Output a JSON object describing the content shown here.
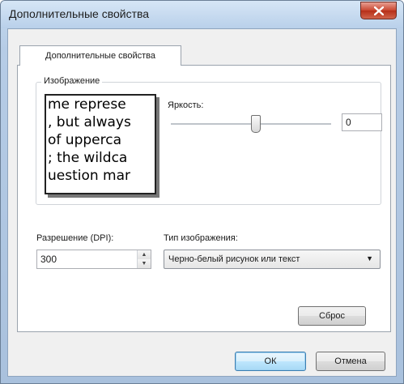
{
  "window": {
    "title": "Дополнительные свойства",
    "close_glyph": "✕"
  },
  "tabs": [
    {
      "label": "Дополнительные свойства",
      "selected": true
    }
  ],
  "image_group": {
    "legend": "Изображение",
    "preview_lines": [
      "me represe",
      ", but always",
      " of upperca",
      "; the wildca",
      "uestion mar"
    ]
  },
  "brightness": {
    "label": "Яркость:",
    "value": "0",
    "slider_level": 0.5
  },
  "resolution": {
    "label": "Разрешение (DPI):",
    "value": "300",
    "up_glyph": "▲",
    "down_glyph": "▼"
  },
  "image_type": {
    "label": "Тип изображения:",
    "selected": "Черно-белый рисунок или текст",
    "arrow_glyph": "▼"
  },
  "buttons": {
    "reset": "Сброс",
    "ok": "ОК",
    "cancel": "Отмена"
  },
  "colors": {
    "frame": "#b9d0ea",
    "close_button": "#c8452f",
    "default_button_border": "#3c7fb1"
  }
}
